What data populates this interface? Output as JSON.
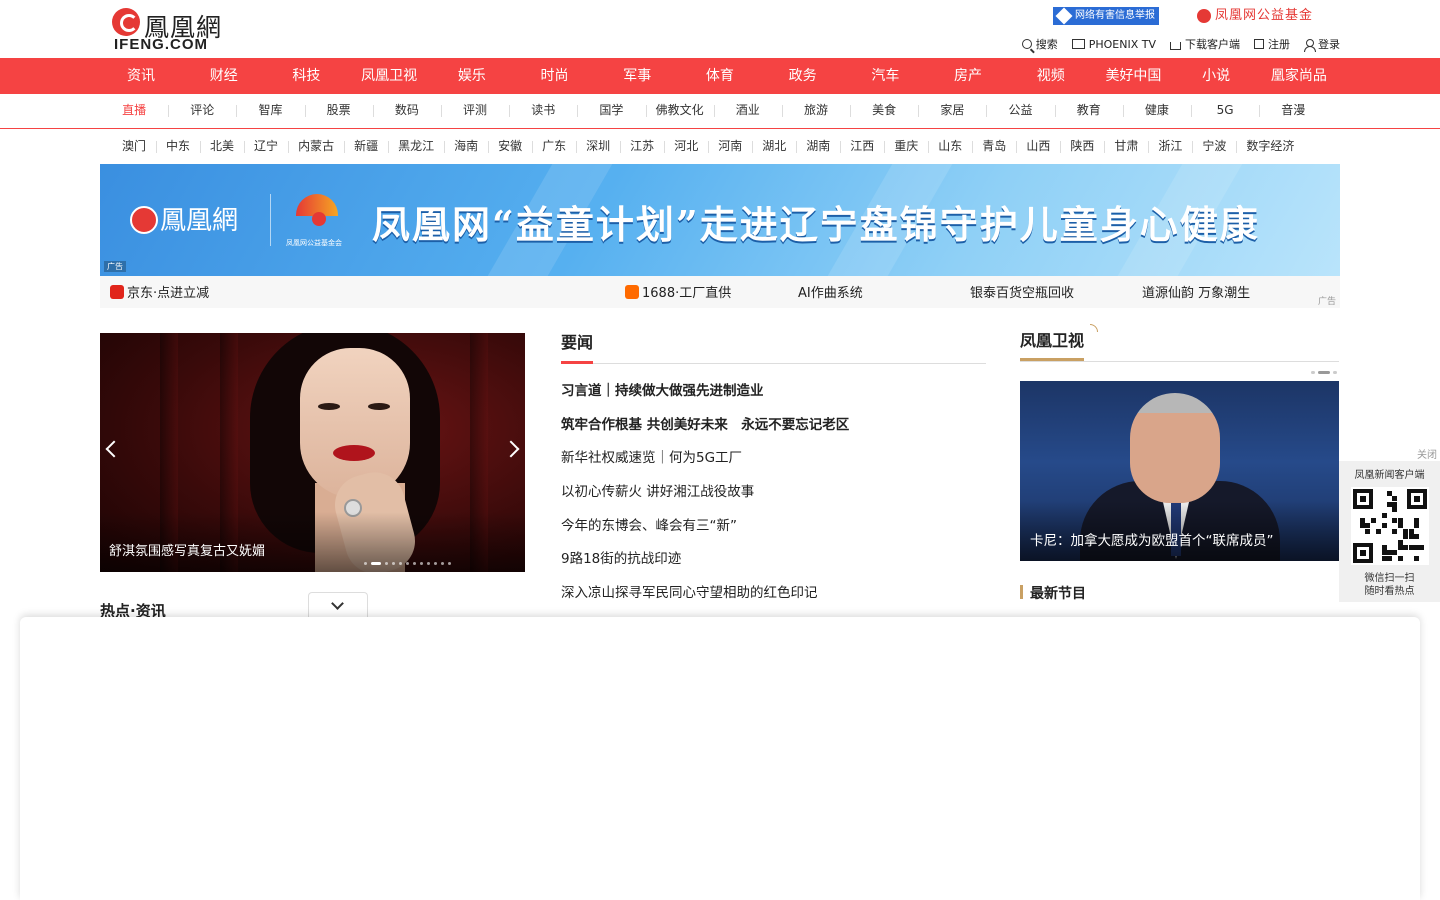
{
  "brand": {
    "logo_cn": "鳳凰網",
    "logo_en": "IFENG.COM"
  },
  "header": {
    "report_badge": "网络有害信息举报",
    "foundation": "凤凰网公益基金",
    "links": [
      {
        "label": "搜索",
        "icon": "search-icon"
      },
      {
        "label": "PHOENIX TV",
        "icon": "tv-icon"
      },
      {
        "label": "下载客户端",
        "icon": "download-icon"
      },
      {
        "label": "注册",
        "icon": "edit-icon"
      },
      {
        "label": "登录",
        "icon": "user-icon"
      }
    ]
  },
  "main_nav": [
    "资讯",
    "财经",
    "科技",
    "凤凰卫视",
    "娱乐",
    "时尚",
    "军事",
    "体育",
    "政务",
    "汽车",
    "房产",
    "视频",
    "美好中国",
    "小说",
    "凰家尚品"
  ],
  "sub_nav": [
    "直播",
    "评论",
    "智库",
    "股票",
    "数码",
    "评测",
    "读书",
    "国学",
    "佛教文化",
    "酒业",
    "旅游",
    "美食",
    "家居",
    "公益",
    "教育",
    "健康",
    "5G",
    "音漫"
  ],
  "regions": [
    "澳门",
    "中东",
    "北美",
    "辽宁",
    "内蒙古",
    "新疆",
    "黑龙江",
    "海南",
    "安徽",
    "广东",
    "深圳",
    "江苏",
    "河北",
    "河南",
    "湖北",
    "湖南",
    "江西",
    "重庆",
    "山东",
    "青岛",
    "山西",
    "陕西",
    "甘肃",
    "浙江",
    "宁波",
    "数字经济"
  ],
  "banner": {
    "logo": "鳳凰網",
    "title": "凤凰网“益童计划”走进辽宁盘锦守护儿童身心健康",
    "sub_caption": "凤凰网公益基金会",
    "ad_tag": "广告"
  },
  "ad_links": {
    "items": [
      "京东·点进立减",
      "1688·工厂直供",
      "AI作曲系统",
      "银泰百货空瓶回收",
      "道源仙韵 万象潮生"
    ],
    "ad_tag": "广告",
    "colors": {
      "jd": "#e1251b",
      "ali": "#ff6a00"
    }
  },
  "slider": {
    "caption": "舒淇氛围感写真复古又妩媚",
    "dot_count": 12,
    "active_dot": 1
  },
  "hot": {
    "title": "热点·资讯"
  },
  "news": {
    "title": "要闻",
    "items": [
      {
        "text": "习言道｜持续做大做强先进制造业",
        "bold": true
      },
      {
        "text": "筑牢合作根基 共创美好未来　永远不要忘记老区",
        "bold": true
      },
      {
        "text": "新华社权威速览｜何为5G工厂",
        "bold": false
      },
      {
        "text": "以初心传薪火 讲好湘江战役故事",
        "bold": false
      },
      {
        "text": "今年的东博会、峰会有三“新”",
        "bold": false
      },
      {
        "text": "9路18街的抗战印迹",
        "bold": false
      },
      {
        "text": "深入凉山探寻军民同心守望相助的红色印记",
        "bold": false
      }
    ]
  },
  "phoenix_tv": {
    "title": "凤凰卫视",
    "caption": "卡尼：加拿大愿成为欧盟首个“联席成员”",
    "latest_title": "最新节目"
  },
  "qr": {
    "close": "关闭",
    "title": "凤凰新闻客户端",
    "line1": "微信扫一扫",
    "line2": "随时看热点"
  },
  "theme": {
    "accent": "#f54343",
    "gold": "#c9a063"
  }
}
